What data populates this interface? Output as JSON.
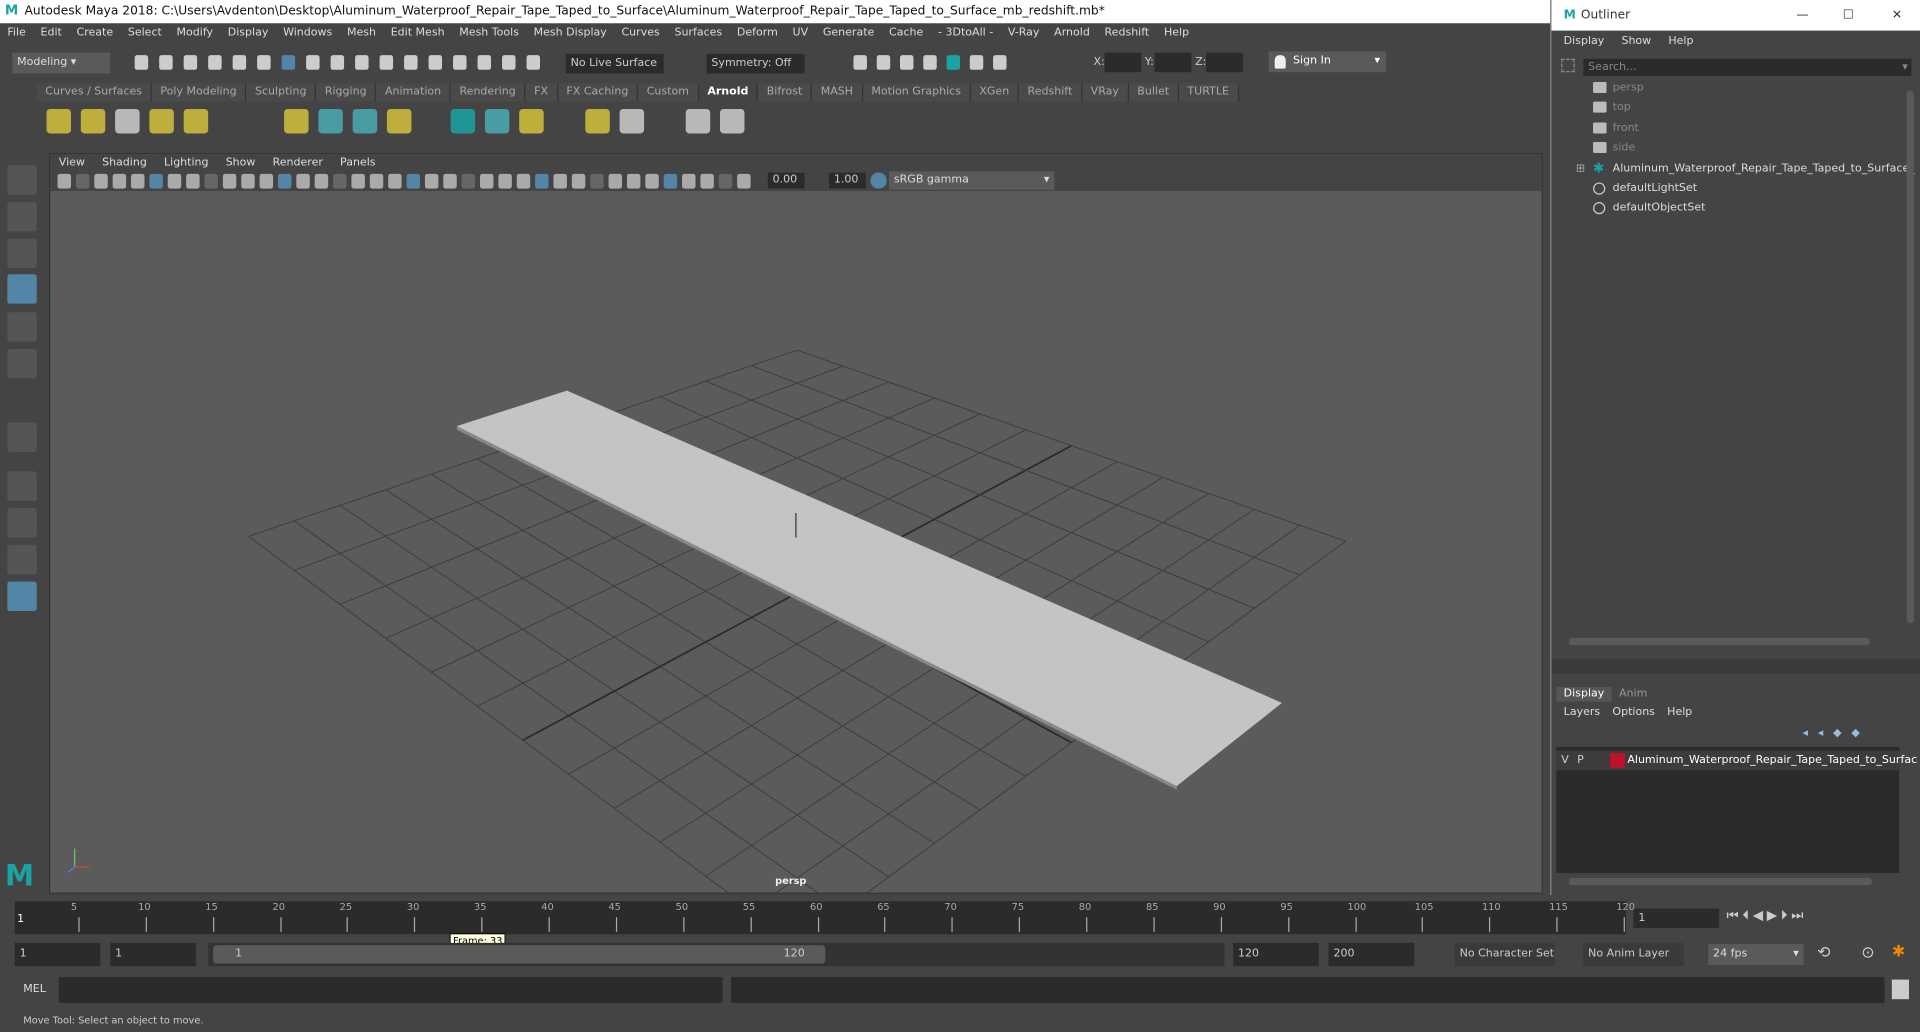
{
  "window": {
    "title": "Autodesk Maya 2018: C:\\Users\\Avdenton\\Desktop\\Aluminum_Waterproof_Repair_Tape_Taped_to_Surface\\Aluminum_Waterproof_Repair_Tape_Taped_to_Surface_mb_redshift.mb*",
    "logo": "M"
  },
  "menu": [
    "File",
    "Edit",
    "Create",
    "Select",
    "Modify",
    "Display",
    "Windows",
    "Mesh",
    "Edit Mesh",
    "Mesh Tools",
    "Mesh Display",
    "Curves",
    "Surfaces",
    "Deform",
    "UV",
    "Generate",
    "Cache",
    "- 3DtoAll -",
    "V-Ray",
    "Arnold",
    "Redshift",
    "Help"
  ],
  "toolbar": {
    "mode": "Modeling",
    "live_surface": "No Live Surface",
    "symmetry": "Symmetry: Off",
    "x_label": "X:",
    "y_label": "Y:",
    "z_label": "Z:",
    "sign_in": "Sign In"
  },
  "shelf_tabs": [
    "Curves / Surfaces",
    "Poly Modeling",
    "Sculpting",
    "Rigging",
    "Animation",
    "Rendering",
    "FX",
    "FX Caching",
    "Custom",
    "Arnold",
    "Bifrost",
    "MASH",
    "Motion Graphics",
    "XGen",
    "Redshift",
    "VRay",
    "Bullet",
    "TURTLE"
  ],
  "active_shelf_tab": "Arnold",
  "viewport": {
    "menu": [
      "View",
      "Shading",
      "Lighting",
      "Show",
      "Renderer",
      "Panels"
    ],
    "exposure": "0.00",
    "gamma": "1.00",
    "color_space": "sRGB gamma",
    "camera_label": "persp"
  },
  "timeline": {
    "ticks": [
      "5",
      "10",
      "15",
      "20",
      "25",
      "30",
      "35",
      "40",
      "45",
      "50",
      "55",
      "60",
      "65",
      "70",
      "75",
      "80",
      "85",
      "90",
      "95",
      "100",
      "105",
      "110",
      "115",
      "120"
    ],
    "start_marker": "1",
    "current_frame": "1",
    "tooltip": "Frame: 33"
  },
  "range": {
    "start": "1",
    "inner_start": "1",
    "slider_start": "1",
    "slider_end": "120",
    "end": "120",
    "anim_end": "200",
    "character_set": "No Character Set",
    "anim_layer": "No Anim Layer",
    "fps": "24 fps"
  },
  "command": {
    "label": "MEL"
  },
  "status": "Move Tool: Select an object to move.",
  "outliner": {
    "title": "Outliner",
    "menu": [
      "Display",
      "Show",
      "Help"
    ],
    "search_placeholder": "Search...",
    "items": [
      {
        "label": "persp",
        "icon": "camera-icon",
        "dim": true
      },
      {
        "label": "top",
        "icon": "camera-icon",
        "dim": true
      },
      {
        "label": "front",
        "icon": "camera-icon",
        "dim": true
      },
      {
        "label": "side",
        "icon": "camera-icon",
        "dim": true
      },
      {
        "label": "Aluminum_Waterproof_Repair_Tape_Taped_to_Surface_",
        "icon": "group-icon",
        "dim": false
      },
      {
        "label": "defaultLightSet",
        "icon": "set-icon",
        "dim": false
      },
      {
        "label": "defaultObjectSet",
        "icon": "set-icon",
        "dim": false
      }
    ],
    "layer_tabs": [
      "Display",
      "Anim"
    ],
    "layer_menu": [
      "Layers",
      "Options",
      "Help"
    ],
    "layer": {
      "v": "V",
      "p": "P",
      "name": "Aluminum_Waterproof_Repair_Tape_Taped_to_Surfac",
      "color": "#c0102a"
    }
  },
  "colors": {
    "accent": "#5285a6",
    "teal": "#1aa3a3"
  }
}
